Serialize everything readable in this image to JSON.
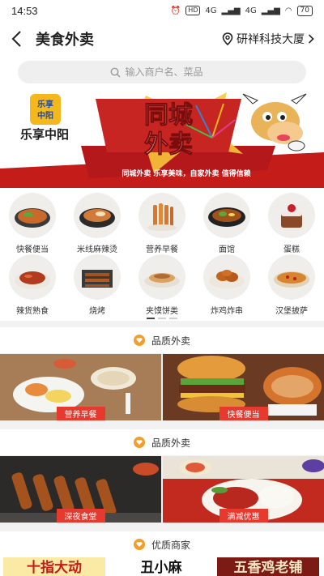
{
  "status_bar": {
    "time": "14:53",
    "hd": "HD",
    "signal_1": "4G",
    "signal_2": "4G",
    "battery": "70"
  },
  "header": {
    "title": "美食外卖",
    "location": "研祥科技大厦"
  },
  "search": {
    "placeholder": "输入商户名、菜品"
  },
  "banner": {
    "logo_top": "乐享",
    "logo_bottom": "中阳",
    "brand": "乐享中阳",
    "headline_1": "同城",
    "headline_2": "外卖",
    "slogan": "同城外卖  乐享美味，自家外卖  值得信赖"
  },
  "categories": [
    {
      "label": "快餐便当",
      "icon": "bento-icon"
    },
    {
      "label": "米线麻辣烫",
      "icon": "noodle-pot-icon"
    },
    {
      "label": "营养早餐",
      "icon": "breakfast-icon"
    },
    {
      "label": "面馆",
      "icon": "noodle-bowl-icon"
    },
    {
      "label": "蛋糕",
      "icon": "cake-icon"
    },
    {
      "label": "辣货熟食",
      "icon": "spicy-food-icon"
    },
    {
      "label": "烧烤",
      "icon": "bbq-icon"
    },
    {
      "label": "夹馍饼类",
      "icon": "flatbread-icon"
    },
    {
      "label": "炸鸡炸串",
      "icon": "fried-chicken-icon"
    },
    {
      "label": "汉堡披萨",
      "icon": "pizza-icon"
    }
  ],
  "sections": [
    {
      "title": "品质外卖",
      "tiles": [
        {
          "tag": "营养早餐"
        },
        {
          "tag": "快餐便当"
        }
      ]
    },
    {
      "title": "品质外卖",
      "tiles": [
        {
          "tag": "深夜食堂"
        },
        {
          "tag": "满减优惠"
        }
      ]
    }
  ],
  "merchants_section": {
    "title": "优质商家"
  },
  "merchants": [
    {
      "name": "十指大动"
    },
    {
      "name": "丑小麻"
    },
    {
      "name": "五香鸡老铺"
    }
  ],
  "colors": {
    "accent": "#e73a2f",
    "heart": "#f59d2a",
    "banner_red": "#c41c19"
  }
}
